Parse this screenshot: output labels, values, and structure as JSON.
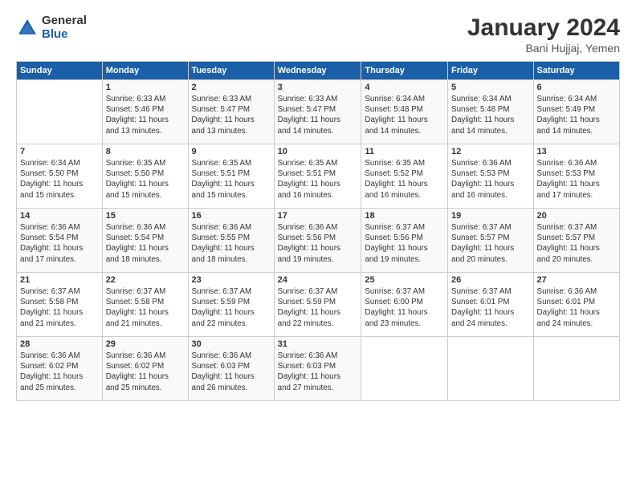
{
  "logo": {
    "general": "General",
    "blue": "Blue"
  },
  "title": "January 2024",
  "subtitle": "Bani Hujjaj, Yemen",
  "headers": [
    "Sunday",
    "Monday",
    "Tuesday",
    "Wednesday",
    "Thursday",
    "Friday",
    "Saturday"
  ],
  "rows": [
    [
      {
        "day": "",
        "info": ""
      },
      {
        "day": "1",
        "info": "Sunrise: 6:33 AM\nSunset: 5:46 PM\nDaylight: 11 hours\nand 13 minutes."
      },
      {
        "day": "2",
        "info": "Sunrise: 6:33 AM\nSunset: 5:47 PM\nDaylight: 11 hours\nand 13 minutes."
      },
      {
        "day": "3",
        "info": "Sunrise: 6:33 AM\nSunset: 5:47 PM\nDaylight: 11 hours\nand 14 minutes."
      },
      {
        "day": "4",
        "info": "Sunrise: 6:34 AM\nSunset: 5:48 PM\nDaylight: 11 hours\nand 14 minutes."
      },
      {
        "day": "5",
        "info": "Sunrise: 6:34 AM\nSunset: 5:48 PM\nDaylight: 11 hours\nand 14 minutes."
      },
      {
        "day": "6",
        "info": "Sunrise: 6:34 AM\nSunset: 5:49 PM\nDaylight: 11 hours\nand 14 minutes."
      }
    ],
    [
      {
        "day": "7",
        "info": "Sunrise: 6:34 AM\nSunset: 5:50 PM\nDaylight: 11 hours\nand 15 minutes."
      },
      {
        "day": "8",
        "info": "Sunrise: 6:35 AM\nSunset: 5:50 PM\nDaylight: 11 hours\nand 15 minutes."
      },
      {
        "day": "9",
        "info": "Sunrise: 6:35 AM\nSunset: 5:51 PM\nDaylight: 11 hours\nand 15 minutes."
      },
      {
        "day": "10",
        "info": "Sunrise: 6:35 AM\nSunset: 5:51 PM\nDaylight: 11 hours\nand 16 minutes."
      },
      {
        "day": "11",
        "info": "Sunrise: 6:35 AM\nSunset: 5:52 PM\nDaylight: 11 hours\nand 16 minutes."
      },
      {
        "day": "12",
        "info": "Sunrise: 6:36 AM\nSunset: 5:53 PM\nDaylight: 11 hours\nand 16 minutes."
      },
      {
        "day": "13",
        "info": "Sunrise: 6:36 AM\nSunset: 5:53 PM\nDaylight: 11 hours\nand 17 minutes."
      }
    ],
    [
      {
        "day": "14",
        "info": "Sunrise: 6:36 AM\nSunset: 5:54 PM\nDaylight: 11 hours\nand 17 minutes."
      },
      {
        "day": "15",
        "info": "Sunrise: 6:36 AM\nSunset: 5:54 PM\nDaylight: 11 hours\nand 18 minutes."
      },
      {
        "day": "16",
        "info": "Sunrise: 6:36 AM\nSunset: 5:55 PM\nDaylight: 11 hours\nand 18 minutes."
      },
      {
        "day": "17",
        "info": "Sunrise: 6:36 AM\nSunset: 5:56 PM\nDaylight: 11 hours\nand 19 minutes."
      },
      {
        "day": "18",
        "info": "Sunrise: 6:37 AM\nSunset: 5:56 PM\nDaylight: 11 hours\nand 19 minutes."
      },
      {
        "day": "19",
        "info": "Sunrise: 6:37 AM\nSunset: 5:57 PM\nDaylight: 11 hours\nand 20 minutes."
      },
      {
        "day": "20",
        "info": "Sunrise: 6:37 AM\nSunset: 5:57 PM\nDaylight: 11 hours\nand 20 minutes."
      }
    ],
    [
      {
        "day": "21",
        "info": "Sunrise: 6:37 AM\nSunset: 5:58 PM\nDaylight: 11 hours\nand 21 minutes."
      },
      {
        "day": "22",
        "info": "Sunrise: 6:37 AM\nSunset: 5:58 PM\nDaylight: 11 hours\nand 21 minutes."
      },
      {
        "day": "23",
        "info": "Sunrise: 6:37 AM\nSunset: 5:59 PM\nDaylight: 11 hours\nand 22 minutes."
      },
      {
        "day": "24",
        "info": "Sunrise: 6:37 AM\nSunset: 5:59 PM\nDaylight: 11 hours\nand 22 minutes."
      },
      {
        "day": "25",
        "info": "Sunrise: 6:37 AM\nSunset: 6:00 PM\nDaylight: 11 hours\nand 23 minutes."
      },
      {
        "day": "26",
        "info": "Sunrise: 6:37 AM\nSunset: 6:01 PM\nDaylight: 11 hours\nand 24 minutes."
      },
      {
        "day": "27",
        "info": "Sunrise: 6:36 AM\nSunset: 6:01 PM\nDaylight: 11 hours\nand 24 minutes."
      }
    ],
    [
      {
        "day": "28",
        "info": "Sunrise: 6:36 AM\nSunset: 6:02 PM\nDaylight: 11 hours\nand 25 minutes."
      },
      {
        "day": "29",
        "info": "Sunrise: 6:36 AM\nSunset: 6:02 PM\nDaylight: 11 hours\nand 25 minutes."
      },
      {
        "day": "30",
        "info": "Sunrise: 6:36 AM\nSunset: 6:03 PM\nDaylight: 11 hours\nand 26 minutes."
      },
      {
        "day": "31",
        "info": "Sunrise: 6:36 AM\nSunset: 6:03 PM\nDaylight: 11 hours\nand 27 minutes."
      },
      {
        "day": "",
        "info": ""
      },
      {
        "day": "",
        "info": ""
      },
      {
        "day": "",
        "info": ""
      }
    ]
  ]
}
